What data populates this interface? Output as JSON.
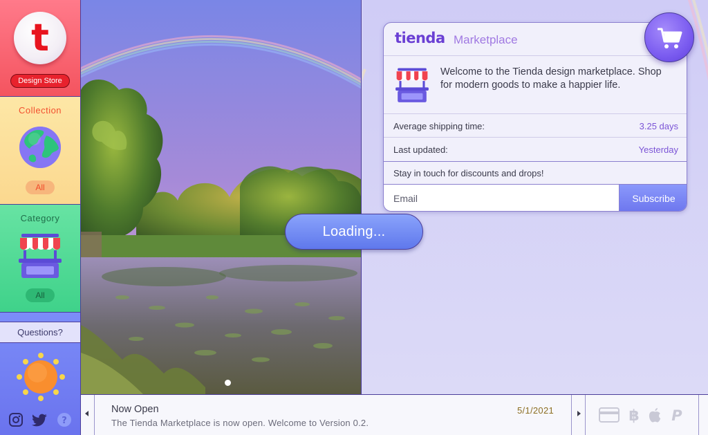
{
  "sidebar": {
    "logo_letter": "t",
    "store_label": "Design Store",
    "collection": {
      "title": "Collection",
      "filter": "All",
      "icon": "globe-icon"
    },
    "category": {
      "title": "Category",
      "filter": "All",
      "icon": "shop-icon"
    },
    "questions": {
      "title": "Questions?",
      "icon": "sun-icon"
    },
    "social": [
      "instagram-icon",
      "twitter-icon",
      "help-icon"
    ]
  },
  "hero": {
    "slides": 1,
    "active_slide": 1
  },
  "card": {
    "brand": "tienda",
    "subtitle": "Marketplace",
    "welcome": "Welcome to the Tienda design marketplace. Shop for modern goods to make a happier life.",
    "rows": [
      {
        "label": "Average shipping time:",
        "value": "3.25 days"
      },
      {
        "label": "Last updated:",
        "value": "Yesterday"
      }
    ],
    "touch": "Stay in touch for discounts and drops!",
    "email_placeholder": "Email",
    "subscribe_label": "Subscribe"
  },
  "loading_label": "Loading...",
  "news": {
    "title": "Now Open",
    "date": "5/1/2021",
    "body": "The Tienda Marketplace is now open. Welcome to Version 0.2."
  },
  "payments": [
    "credit-card-icon",
    "bitcoin-icon",
    "apple-icon",
    "paypal-icon"
  ],
  "colors": {
    "accent": "#6a3fd4",
    "brand_red": "#e8151f",
    "button_blue": "#6d76ee",
    "collection_bg": "#fbd88f",
    "category_bg": "#3fd28a",
    "questions_bg": "#6a73ee"
  }
}
